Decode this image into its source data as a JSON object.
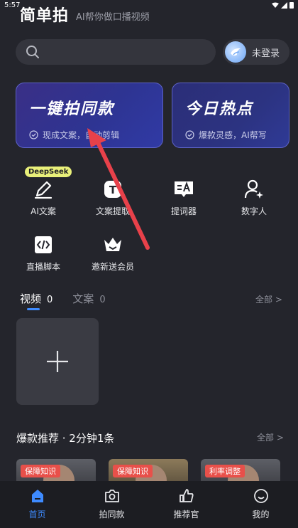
{
  "status_bar": {
    "time": "5:57"
  },
  "header": {
    "logo": "简单拍",
    "tagline": "AI帮你做口播视频"
  },
  "search": {
    "placeholder": ""
  },
  "account": {
    "login_label": "未登录"
  },
  "cards": [
    {
      "title": "一键拍同款",
      "subtitle": "现成文案，自动剪辑"
    },
    {
      "title": "今日热点",
      "subtitle": "爆款灵感，AI帮写"
    }
  ],
  "tools": [
    {
      "label": "AI文案",
      "badge": "DeepSeek",
      "icon": "pen-icon"
    },
    {
      "label": "文案提取",
      "icon": "text-extract-icon"
    },
    {
      "label": "提词器",
      "icon": "teleprompter-icon"
    },
    {
      "label": "数字人",
      "icon": "digital-human-icon"
    },
    {
      "label": "直播脚本",
      "icon": "code-script-icon"
    },
    {
      "label": "邀新送会员",
      "icon": "crown-icon"
    }
  ],
  "tabs": [
    {
      "label": "视频",
      "count": "0",
      "active": true
    },
    {
      "label": "文案",
      "count": "0",
      "active": false
    }
  ],
  "see_all": "全部 >",
  "hot_section": {
    "title": "爆款推荐 · 2分钟1条",
    "see_all": "全部 >",
    "items": [
      {
        "badge": "保障知识"
      },
      {
        "badge": "保障知识"
      },
      {
        "badge": "利率调整"
      }
    ]
  },
  "bottom_nav": [
    {
      "label": "首页",
      "icon": "home-icon",
      "active": true
    },
    {
      "label": "拍同款",
      "icon": "camera-icon",
      "active": false
    },
    {
      "label": "推荐官",
      "icon": "thumbs-up-icon",
      "active": false
    },
    {
      "label": "我的",
      "icon": "smile-icon",
      "active": false
    }
  ],
  "colors": {
    "accent": "#3e8bff",
    "badge": "#e8504a",
    "arrow": "#e8414a"
  }
}
